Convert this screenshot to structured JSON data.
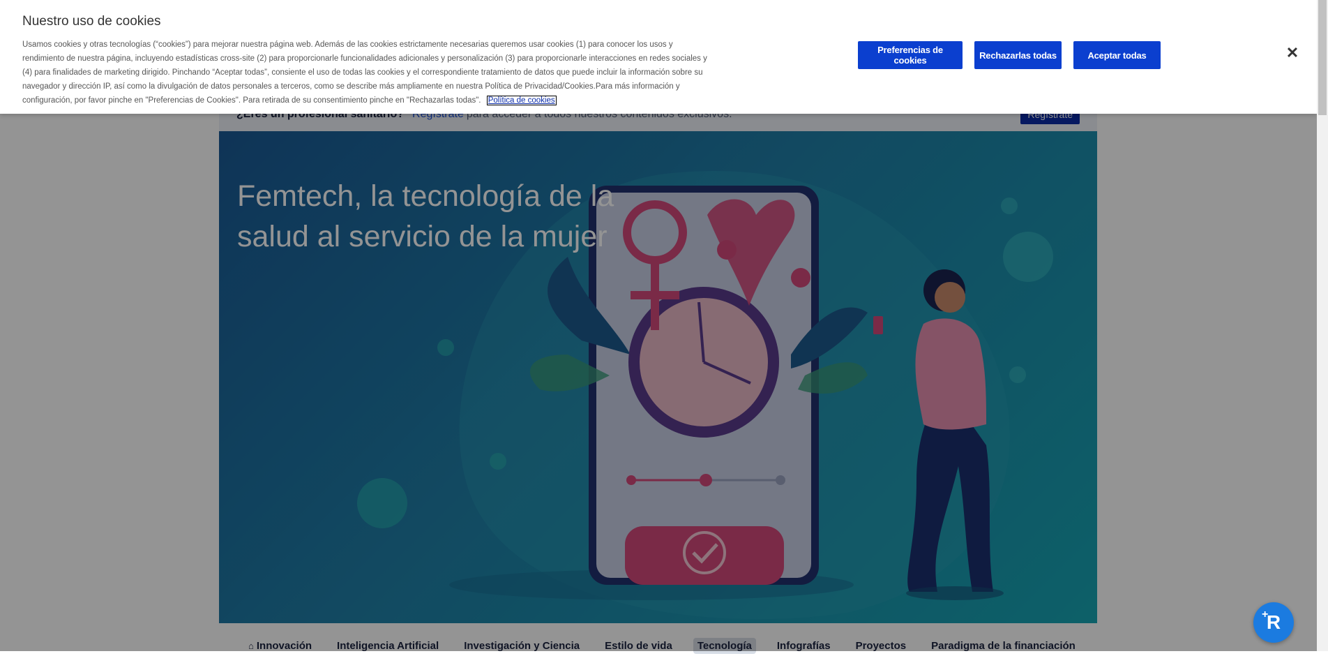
{
  "page": {
    "register_bar": {
      "question": "¿Eres un profesional sanitario?",
      "link": "Regístrate",
      "rest": "para acceder a todos nuestros contenidos exclusivos.",
      "button": "Regístrate"
    },
    "hero": {
      "title": "Femtech, la tecnología de la salud al servicio de la mujer"
    },
    "nav": {
      "items": [
        {
          "label": "Innovación",
          "icon": "home-icon"
        },
        {
          "label": "Inteligencia Artificial"
        },
        {
          "label": "Investigación y Ciencia"
        },
        {
          "label": "Estilo de vida"
        },
        {
          "label": "Tecnología",
          "active": true
        },
        {
          "label": "Infografías"
        },
        {
          "label": "Proyectos"
        },
        {
          "label": "Paradigma de la financiación"
        }
      ]
    }
  },
  "cookie_banner": {
    "title": "Nuestro uso de cookies",
    "text": "Usamos cookies y otras tecnologías (“cookies”) para mejorar nuestra página web. Además de las cookies estrictamente necesarias queremos usar cookies (1) para conocer los usos y rendimiento de nuestra página, incluyendo estadísticas cross-site (2) para proporcionarle funcionalidades adicionales y personalización (3) para proporcionarle interacciones en redes sociales y (4) para finalidades de marketing dirigido. Pinchando “Aceptar todas”, consiente el uso de todas las cookies y el correspondiente tratamiento de datos que puede incluir la información sobre su navegador y dirección IP, así como la divulgación de datos personales a terceros, como se describe más ampliamente en nuestra Política de Privacidad/Cookies.Para más información y configuración, por favor pinche en \"Preferencias de Cookies\". Para retirada de su consentimiento pinche en \"Rechazarlas todas\".",
    "policy_link": "Política de cookies",
    "buttons": {
      "preferences": "Preferencias de cookies",
      "reject": "Rechazarlas todas",
      "accept": "Aceptar todas"
    },
    "close": "✕"
  },
  "colors": {
    "button_blue": "#0b3fcf",
    "hero_start": "#1a5a96",
    "hero_end": "#17a6b4",
    "fab_blue": "#1b7be0"
  }
}
